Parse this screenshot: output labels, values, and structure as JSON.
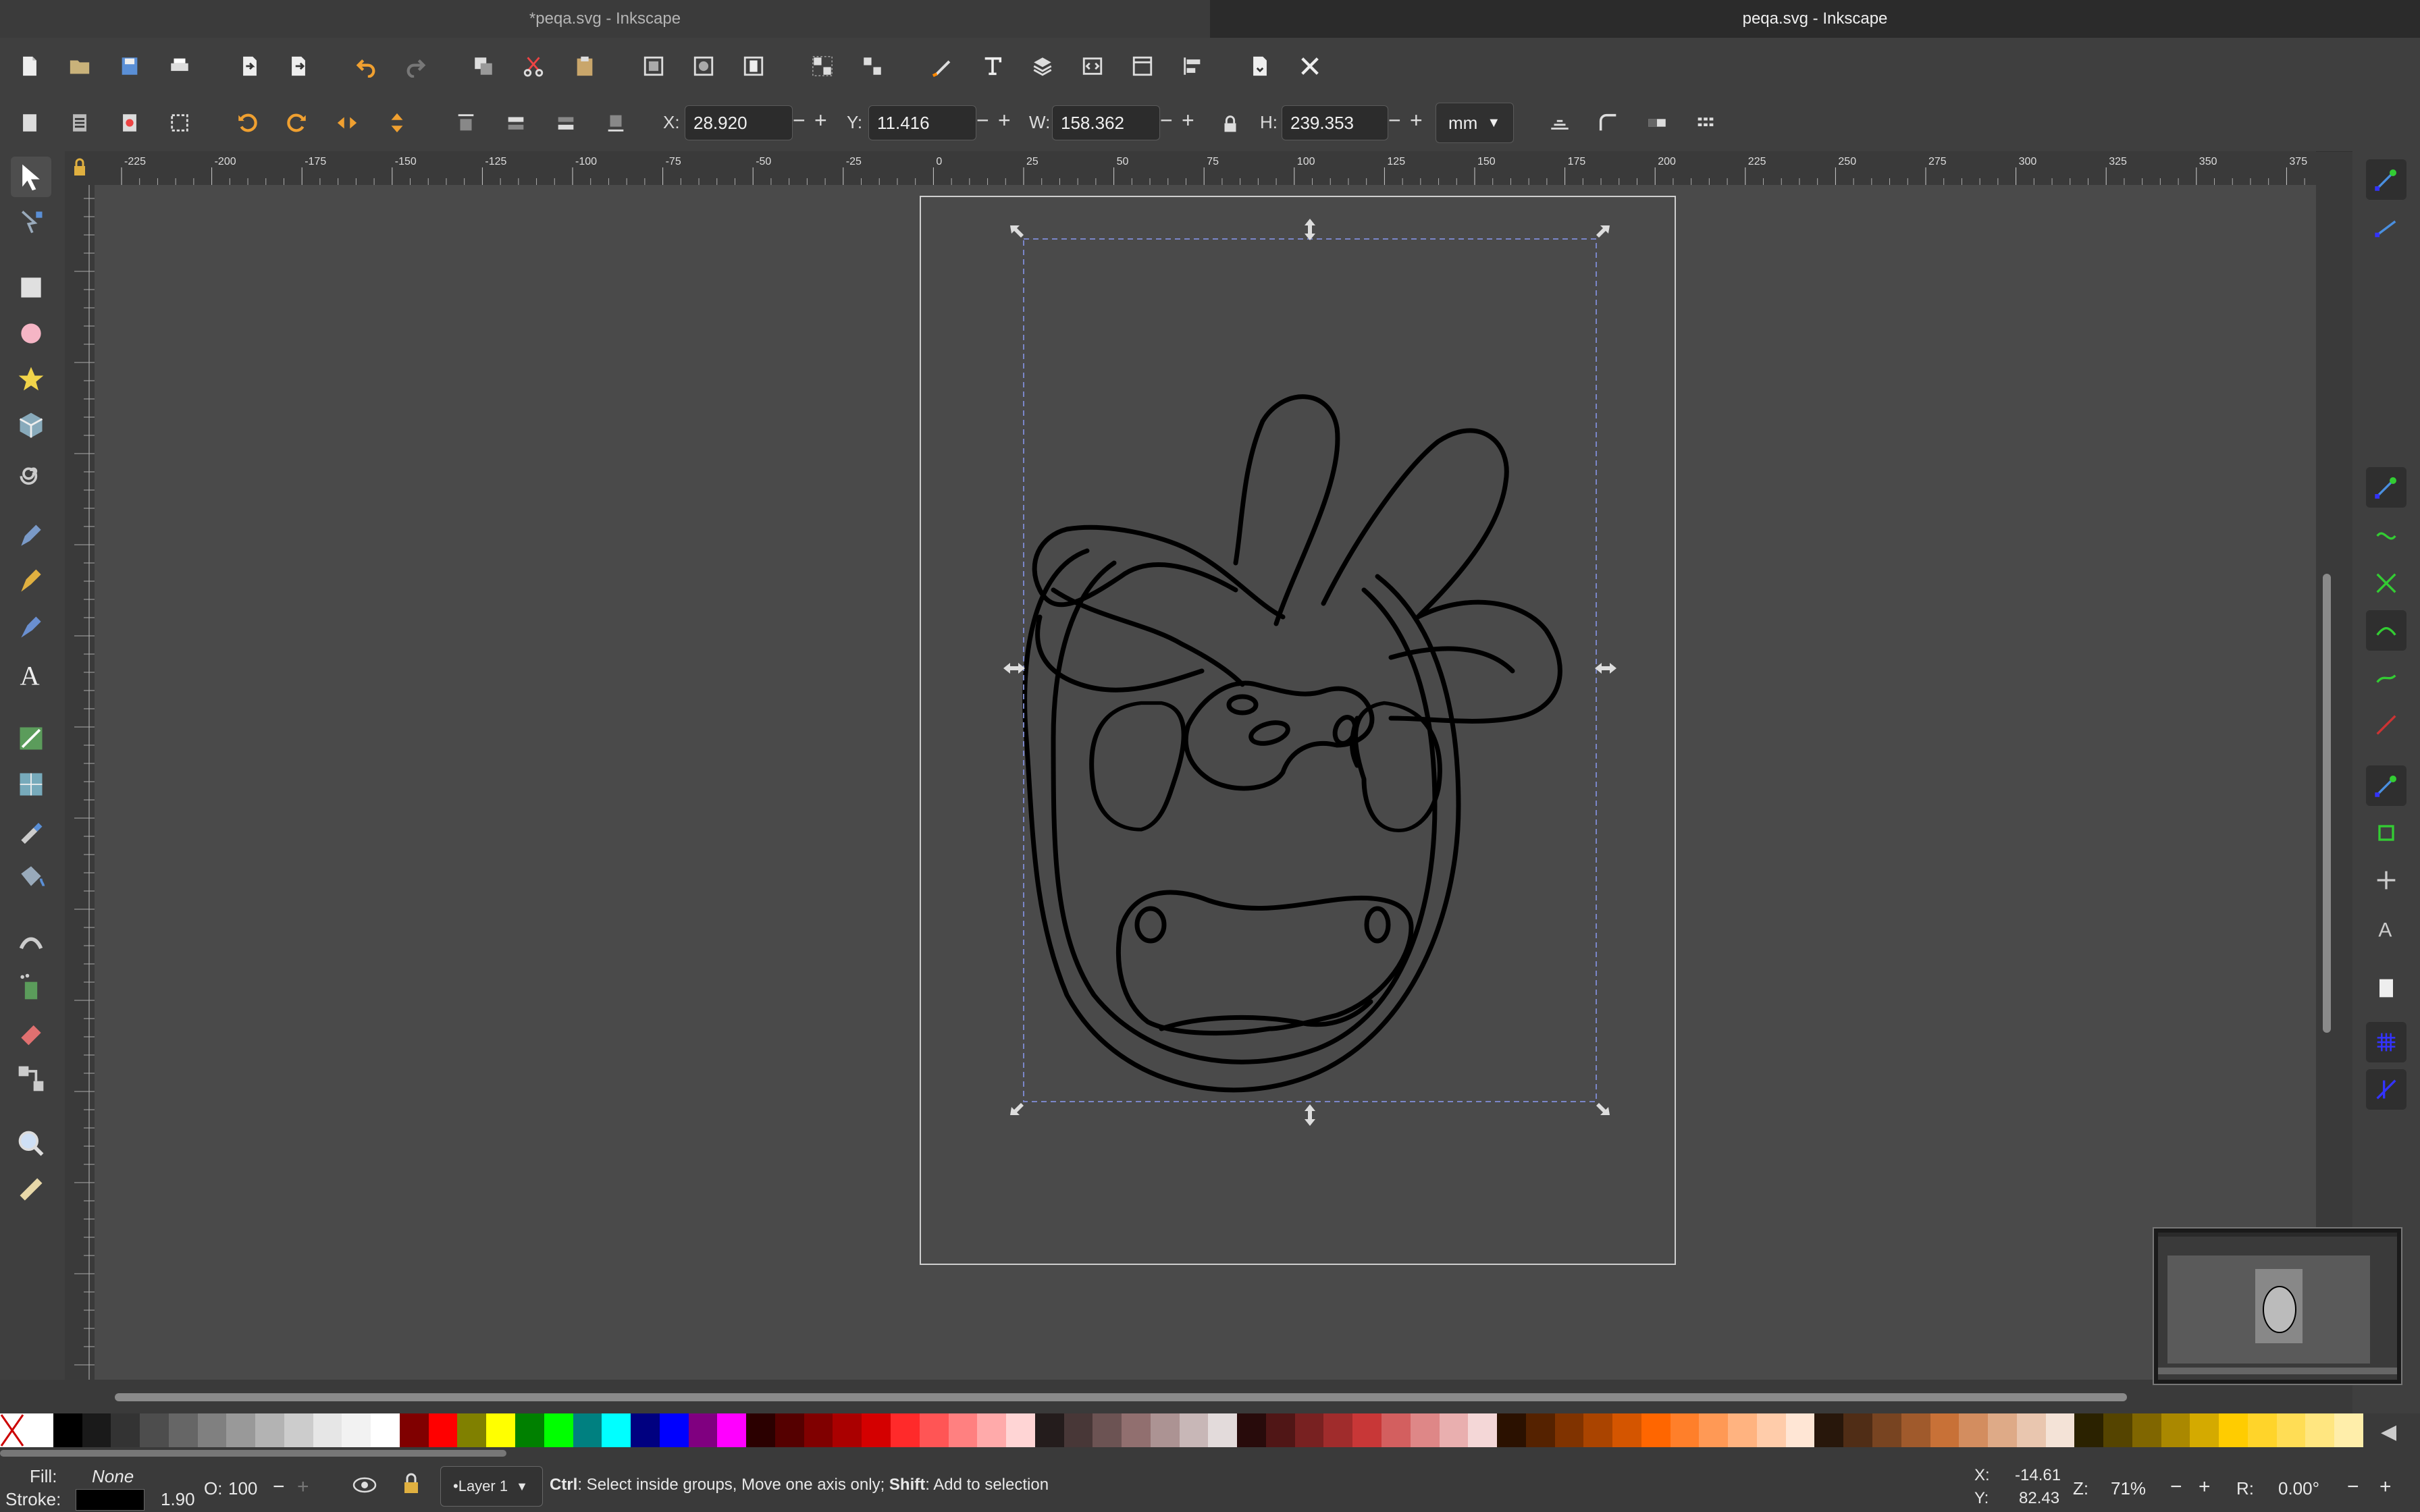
{
  "window": {
    "tabs": [
      {
        "title": "*peqa.svg - Inkscape"
      },
      {
        "title": "peqa.svg - Inkscape"
      }
    ]
  },
  "toolbar_controls": {
    "x_label": "X:",
    "x_value": "28.920",
    "y_label": "Y:",
    "y_value": "11.416",
    "w_label": "W:",
    "w_value": "158.362",
    "h_label": "H:",
    "h_value": "239.353",
    "unit": "mm",
    "minus": "−",
    "plus": "+"
  },
  "ruler": {
    "h_ticks": [
      "-225",
      "-200",
      "-175",
      "-150",
      "-125",
      "-100",
      "-75",
      "-50",
      "-25",
      "0",
      "25",
      "50",
      "75",
      "100",
      "125",
      "150",
      "175",
      "200",
      "225",
      "250",
      "275",
      "300",
      "325",
      "350",
      "375"
    ]
  },
  "status": {
    "fill_label": "Fill:",
    "fill_value": "None",
    "stroke_label": "Stroke:",
    "stroke_width": "1.90",
    "opacity_label": "O:",
    "opacity_value": "100",
    "layer": "•Layer 1",
    "message_ctrl": "Ctrl",
    "message_part1": ": Select inside groups, Move one axis only; ",
    "message_shift": "Shift",
    "message_part2": ": Add to selection",
    "x_label": "X:",
    "x_value": "-14.61",
    "y_label": "Y:",
    "y_value": "82.43",
    "zoom_label": "Z:",
    "zoom_value": "71%",
    "rotate_label": "R:",
    "rotate_value": "0.00°"
  },
  "palette_colors": [
    "#ffffff",
    "#000000",
    "#1a1a1a",
    "#333333",
    "#4d4d4d",
    "#666666",
    "#808080",
    "#999999",
    "#b3b3b3",
    "#cccccc",
    "#e6e6e6",
    "#f2f2f2",
    "#ffffff",
    "#800000",
    "#ff0000",
    "#808000",
    "#ffff00",
    "#008000",
    "#00ff00",
    "#008080",
    "#00ffff",
    "#000080",
    "#0000ff",
    "#800080",
    "#ff00ff",
    "#2b0000",
    "#550000",
    "#800000",
    "#aa0000",
    "#d40000",
    "#ff2a2a",
    "#ff5555",
    "#ff8080",
    "#ffaaaa",
    "#ffd5d5",
    "#241c1c",
    "#483737",
    "#6c5353",
    "#916f6f",
    "#ac9393",
    "#c8b7b7",
    "#e3dbdb",
    "#280b0b",
    "#501616",
    "#782121",
    "#a02c2c",
    "#c83737",
    "#d35f5f",
    "#de8787",
    "#e9afaf",
    "#f4d7d7",
    "#2b1100",
    "#552200",
    "#803300",
    "#aa4400",
    "#d45500",
    "#ff6600",
    "#ff7f2a",
    "#ff9955",
    "#ffb380",
    "#ffccaa",
    "#ffe6d5",
    "#28170b",
    "#502d16",
    "#784421",
    "#a05a2c",
    "#c87137",
    "#d38d5f",
    "#deaa87",
    "#e9c6af",
    "#f4e3d7",
    "#2b2200",
    "#554400",
    "#806600",
    "#aa8800",
    "#d4aa00",
    "#ffcc00",
    "#ffd42a",
    "#ffdd55",
    "#ffe680",
    "#ffeeaa"
  ]
}
